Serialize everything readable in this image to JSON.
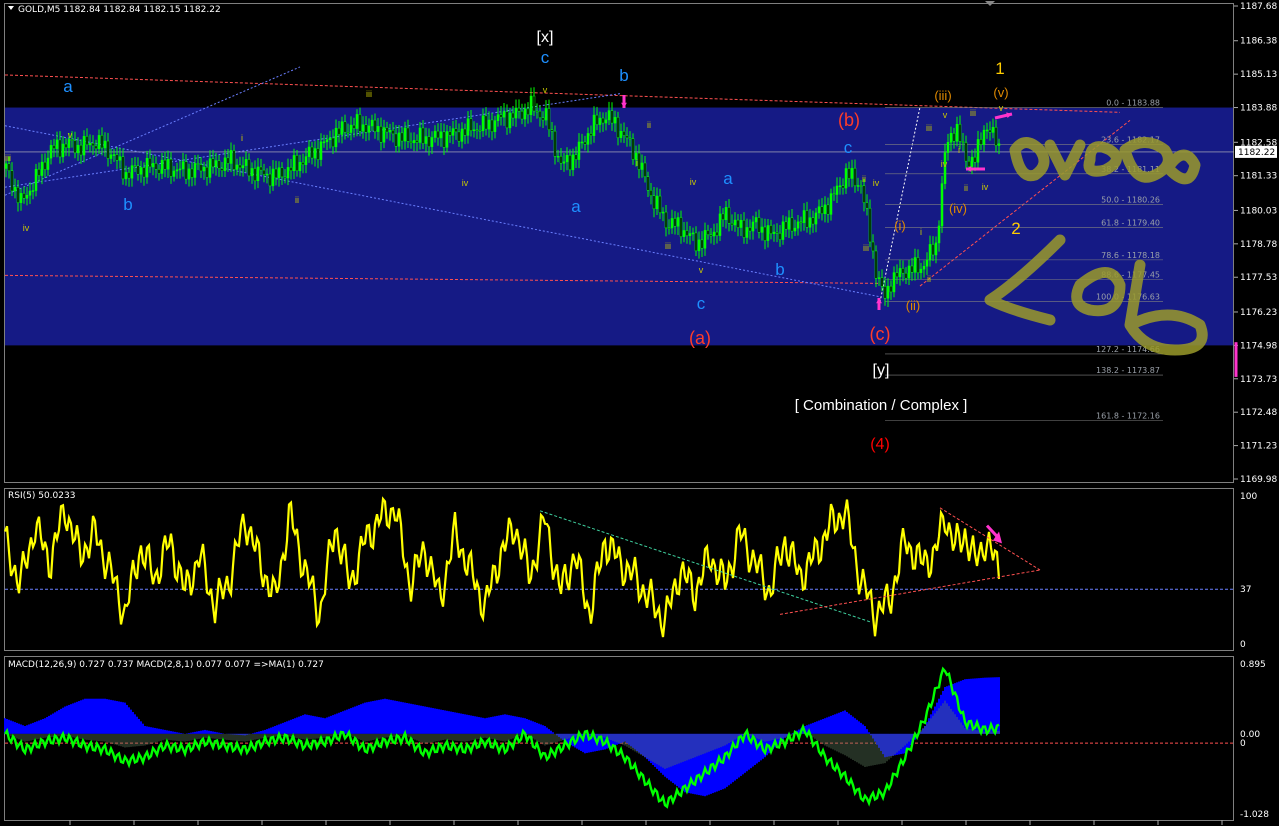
{
  "window": {
    "symbol_header": "GOLD,M5 1182.84 1182.84 1182.15 1182.22",
    "rsi_header": "RSI(5) 50.0233",
    "macd_header": "MACD(12,26,9) 0.727 0.737 MACD(2,8,1) 0.077 0.077 =>MA(1) 0.727",
    "current_price": "1182.22"
  },
  "colors": {
    "background": "#000000",
    "zone": "#151a85",
    "candle": "#00ff00",
    "rsi_line": "#ffff00",
    "macd_green": "#00ff00",
    "macd_blue": "#0000ff",
    "wave_cyan": "#1e90ff",
    "wave_red": "#ff3c28",
    "wave_yellow": "#ffcc00",
    "wave_orange": "#e08a00",
    "wave_olive": "#c9c900",
    "arrow_magenta": "#ff33cc",
    "logo_olive": "#9a9a2a"
  },
  "chart_data": [
    {
      "type": "line",
      "name": "price",
      "ylim": [
        1169.98,
        1187.68
      ],
      "y_ticks": [
        "1187.68",
        "1186.38",
        "1185.13",
        "1183.88",
        "1182.58",
        "1181.33",
        "1180.03",
        "1178.78",
        "1177.53",
        "1176.23",
        "1174.98",
        "1173.73",
        "1172.48",
        "1171.23",
        "1169.98"
      ],
      "x": [
        0,
        15,
        30,
        45,
        60,
        75,
        90,
        105,
        120,
        135,
        150,
        165,
        180,
        195,
        210,
        225,
        240,
        255,
        270,
        285,
        300,
        315,
        330,
        345,
        360,
        375,
        390,
        405,
        420,
        435,
        450,
        465,
        480,
        495,
        510,
        525,
        540,
        555,
        570,
        585,
        600,
        615,
        630,
        645,
        660,
        675,
        690,
        705,
        720,
        735,
        750,
        765,
        780,
        795,
        810,
        825,
        840,
        855,
        870,
        878,
        885,
        900,
        915,
        930,
        940,
        950,
        960,
        970,
        980,
        995
      ],
      "values": [
        1181.6,
        1180.3,
        1181.2,
        1182.3,
        1182.5,
        1182.4,
        1182.6,
        1182.2,
        1181.4,
        1181.6,
        1181.7,
        1181.6,
        1181.5,
        1181.6,
        1181.7,
        1181.9,
        1181.6,
        1181.4,
        1181.3,
        1181.6,
        1182.0,
        1182.4,
        1182.9,
        1183.2,
        1183.2,
        1183.0,
        1182.8,
        1182.7,
        1182.7,
        1182.8,
        1182.9,
        1183.1,
        1183.2,
        1183.5,
        1183.6,
        1183.9,
        1183.5,
        1181.7,
        1182.1,
        1183.1,
        1183.6,
        1183.0,
        1182.1,
        1180.6,
        1179.6,
        1179.4,
        1178.8,
        1179.1,
        1179.9,
        1179.3,
        1179.5,
        1179.1,
        1179.4,
        1179.6,
        1179.8,
        1180.4,
        1181.4,
        1181.0,
        1177.8,
        1176.7,
        1177.4,
        1177.8,
        1177.9,
        1178.7,
        1182.4,
        1183.2,
        1181.9,
        1182.0,
        1183.3,
        1182.22
      ]
    },
    {
      "type": "line",
      "name": "RSI(5)",
      "ylim": [
        0,
        100
      ],
      "y_ticks": [
        "100",
        "37",
        "0"
      ],
      "level": 37,
      "x": [
        0,
        15,
        30,
        45,
        60,
        75,
        90,
        105,
        120,
        135,
        150,
        165,
        180,
        195,
        210,
        225,
        240,
        255,
        270,
        285,
        300,
        315,
        330,
        345,
        360,
        375,
        390,
        405,
        420,
        435,
        450,
        465,
        480,
        495,
        510,
        525,
        540,
        555,
        570,
        585,
        600,
        615,
        630,
        645,
        660,
        675,
        690,
        705,
        720,
        735,
        750,
        765,
        780,
        795,
        810,
        825,
        840,
        855,
        870,
        885,
        900,
        915,
        930,
        940,
        950,
        960,
        970,
        980,
        995
      ],
      "values": [
        70,
        40,
        80,
        55,
        92,
        60,
        75,
        50,
        20,
        65,
        45,
        70,
        35,
        60,
        25,
        45,
        85,
        55,
        30,
        88,
        50,
        20,
        80,
        40,
        70,
        85,
        92,
        40,
        65,
        30,
        75,
        50,
        25,
        60,
        80,
        45,
        85,
        35,
        60,
        20,
        70,
        55,
        45,
        30,
        15,
        50,
        35,
        60,
        40,
        75,
        55,
        35,
        70,
        45,
        60,
        80,
        90,
        45,
        20,
        30,
        70,
        55,
        60,
        88,
        65,
        75,
        55,
        70,
        50
      ]
    },
    {
      "type": "area",
      "name": "MACD",
      "ylim": [
        -1.028,
        0.895
      ],
      "y_ticks": [
        "0.895",
        "0.00",
        "0",
        "-1.028"
      ],
      "x": [
        0,
        20,
        40,
        60,
        80,
        100,
        120,
        140,
        160,
        180,
        200,
        220,
        240,
        260,
        280,
        300,
        320,
        340,
        360,
        380,
        400,
        420,
        440,
        460,
        480,
        500,
        520,
        540,
        560,
        580,
        600,
        620,
        640,
        660,
        680,
        700,
        720,
        740,
        760,
        780,
        800,
        820,
        840,
        860,
        880,
        900,
        920,
        940,
        960,
        980,
        995
      ],
      "blue": [
        0.2,
        0.1,
        0.2,
        0.35,
        0.45,
        0.45,
        0.4,
        0.1,
        0.05,
        0.0,
        0.05,
        0.0,
        -0.02,
        0.05,
        0.15,
        0.25,
        0.2,
        0.3,
        0.4,
        0.45,
        0.4,
        0.35,
        0.3,
        0.25,
        0.2,
        0.25,
        0.2,
        0.1,
        -0.1,
        -0.25,
        -0.2,
        -0.1,
        -0.3,
        -0.55,
        -0.75,
        -0.8,
        -0.7,
        -0.5,
        -0.3,
        -0.05,
        0.1,
        0.2,
        0.3,
        0.1,
        -0.3,
        -0.25,
        0.1,
        0.6,
        0.7,
        0.72,
        0.727
      ],
      "green": [
        0.0,
        -0.2,
        -0.1,
        -0.05,
        -0.15,
        -0.2,
        -0.35,
        -0.3,
        -0.15,
        -0.2,
        -0.1,
        -0.15,
        -0.2,
        -0.1,
        -0.05,
        -0.15,
        -0.1,
        0.0,
        -0.2,
        -0.1,
        -0.05,
        -0.25,
        -0.15,
        -0.2,
        -0.1,
        -0.2,
        0.0,
        -0.3,
        -0.15,
        0.0,
        -0.1,
        -0.3,
        -0.6,
        -0.9,
        -0.7,
        -0.5,
        -0.3,
        0.0,
        -0.2,
        -0.1,
        0.05,
        -0.3,
        -0.55,
        -0.85,
        -0.75,
        -0.3,
        0.2,
        0.85,
        0.15,
        0.05,
        0.077
      ]
    }
  ],
  "fib_levels": [
    {
      "label": "0.0 - 1183.88",
      "price": 1183.88
    },
    {
      "label": "23.6 - 1182.17",
      "price": 1182.5
    },
    {
      "label": "38.2 - 1181.11",
      "price": 1181.4
    },
    {
      "label": "50.0 - 1180.26",
      "price": 1180.26
    },
    {
      "label": "61.8 - 1179.40",
      "price": 1179.4
    },
    {
      "label": "78.6 - 1178.18",
      "price": 1178.18
    },
    {
      "label": "88.6 - 1177.45",
      "price": 1177.45
    },
    {
      "label": "100.0 - 1176.63",
      "price": 1176.63
    },
    {
      "label": "127.2 - 1174.66",
      "price": 1174.66
    },
    {
      "label": "138.2 - 1173.87",
      "price": 1173.87
    },
    {
      "label": "161.8 - 1172.16",
      "price": 1172.16
    }
  ],
  "wave_labels": [
    {
      "text": "a",
      "color": "wave_cyan",
      "size": 17,
      "x": 68,
      "y": 92
    },
    {
      "text": "b",
      "color": "wave_cyan",
      "size": 17,
      "x": 128,
      "y": 210
    },
    {
      "text": "[x]",
      "color": "white",
      "size": 16,
      "x": 545,
      "y": 42
    },
    {
      "text": "c",
      "color": "wave_cyan",
      "size": 17,
      "x": 545,
      "y": 63
    },
    {
      "text": "b",
      "color": "wave_cyan",
      "size": 17,
      "x": 624,
      "y": 81
    },
    {
      "text": "a",
      "color": "wave_cyan",
      "size": 17,
      "x": 576,
      "y": 212
    },
    {
      "text": "a",
      "color": "wave_cyan",
      "size": 17,
      "x": 728,
      "y": 184
    },
    {
      "text": "b",
      "color": "wave_cyan",
      "size": 17,
      "x": 780,
      "y": 275
    },
    {
      "text": "c",
      "color": "wave_cyan",
      "size": 17,
      "x": 701,
      "y": 309
    },
    {
      "text": "(a)",
      "color": "wave_red",
      "size": 18,
      "x": 700,
      "y": 344
    },
    {
      "text": "c",
      "color": "wave_cyan",
      "size": 17,
      "x": 848,
      "y": 153
    },
    {
      "text": "(b)",
      "color": "wave_red",
      "size": 18,
      "x": 849,
      "y": 126
    },
    {
      "text": "(c)",
      "color": "wave_red",
      "size": 18,
      "x": 880,
      "y": 340
    },
    {
      "text": "[y]",
      "color": "white",
      "size": 16,
      "x": 881,
      "y": 375
    },
    {
      "text": "[ Combination / Complex ]",
      "color": "white",
      "size": 15,
      "x": 881,
      "y": 410
    },
    {
      "text": "(4)",
      "color": "red",
      "size": 16,
      "x": 880,
      "y": 449
    },
    {
      "text": "1",
      "color": "wave_yellow",
      "size": 17,
      "x": 1000,
      "y": 74
    },
    {
      "text": "2",
      "color": "wave_yellow",
      "size": 17,
      "x": 1016,
      "y": 234
    },
    {
      "text": "(iii)",
      "color": "wave_orange",
      "size": 13,
      "x": 943,
      "y": 100
    },
    {
      "text": "(v)",
      "color": "wave_orange",
      "size": 13,
      "x": 1001,
      "y": 97
    },
    {
      "text": "(iv)",
      "color": "wave_orange",
      "size": 13,
      "x": 958,
      "y": 213
    },
    {
      "text": "(i)",
      "color": "wave_orange",
      "size": 13,
      "x": 900,
      "y": 230
    },
    {
      "text": "(ii)",
      "color": "wave_orange",
      "size": 13,
      "x": 913,
      "y": 310
    }
  ],
  "minor_labels": [
    {
      "text": "iii",
      "x": 8,
      "y": 161
    },
    {
      "text": "v",
      "x": 70,
      "y": 138
    },
    {
      "text": "iv",
      "x": 26,
      "y": 231
    },
    {
      "text": "iii",
      "x": 369,
      "y": 97
    },
    {
      "text": "v",
      "x": 545,
      "y": 93
    },
    {
      "text": "i",
      "x": 242,
      "y": 141
    },
    {
      "text": "ii",
      "x": 297,
      "y": 203
    },
    {
      "text": "iv",
      "x": 465,
      "y": 186
    },
    {
      "text": "i",
      "x": 637,
      "y": 166
    },
    {
      "text": "ii",
      "x": 649,
      "y": 128
    },
    {
      "text": "iv",
      "x": 693,
      "y": 185
    },
    {
      "text": "iii",
      "x": 668,
      "y": 249
    },
    {
      "text": "v",
      "x": 701,
      "y": 273
    },
    {
      "text": "iv",
      "x": 876,
      "y": 186
    },
    {
      "text": "ii",
      "x": 864,
      "y": 182
    },
    {
      "text": "iii",
      "x": 866,
      "y": 251
    },
    {
      "text": "v",
      "x": 945,
      "y": 118
    },
    {
      "text": "iii",
      "x": 929,
      "y": 131
    },
    {
      "text": "iv",
      "x": 944,
      "y": 167
    },
    {
      "text": "ii",
      "x": 966,
      "y": 191
    },
    {
      "text": "iv",
      "x": 985,
      "y": 190
    },
    {
      "text": "iii",
      "x": 973,
      "y": 116
    },
    {
      "text": "v",
      "x": 1001,
      "y": 111
    },
    {
      "text": "i",
      "x": 959,
      "y": 153
    },
    {
      "text": "i",
      "x": 921,
      "y": 235
    },
    {
      "text": "ii",
      "x": 929,
      "y": 282
    }
  ]
}
